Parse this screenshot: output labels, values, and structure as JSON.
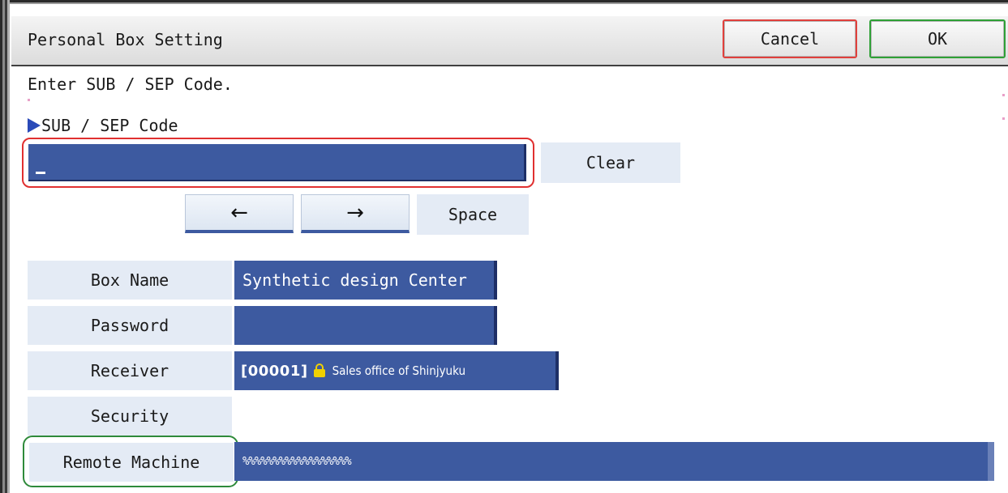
{
  "header": {
    "title": "Personal Box Setting",
    "cancel_label": "Cancel",
    "ok_label": "OK"
  },
  "instruction": "Enter SUB / SEP Code.",
  "code_field": {
    "label": "SUB / SEP Code",
    "value": "",
    "clear_label": "Clear"
  },
  "cursor_controls": {
    "left_arrow": "←",
    "right_arrow": "→",
    "space_label": "Space"
  },
  "rows": {
    "box_name": {
      "label": "Box Name",
      "value": "Synthetic design Center"
    },
    "password": {
      "label": "Password",
      "value": ""
    },
    "receiver": {
      "label": "Receiver",
      "code": "[00001]",
      "name": "Sales office of Shinjyuku",
      "icon": "lock-icon"
    },
    "security": {
      "label": "Security",
      "value": ""
    },
    "remote_machine": {
      "label": "Remote Machine",
      "value": "%%%%%%%%%%%%%%%%%%"
    }
  },
  "colors": {
    "field_blue": "#3d5aa0",
    "cancel_border": "#e0403c",
    "ok_border": "#2ea035",
    "focus_red": "#e03030",
    "focus_green": "#2e8a3a"
  }
}
